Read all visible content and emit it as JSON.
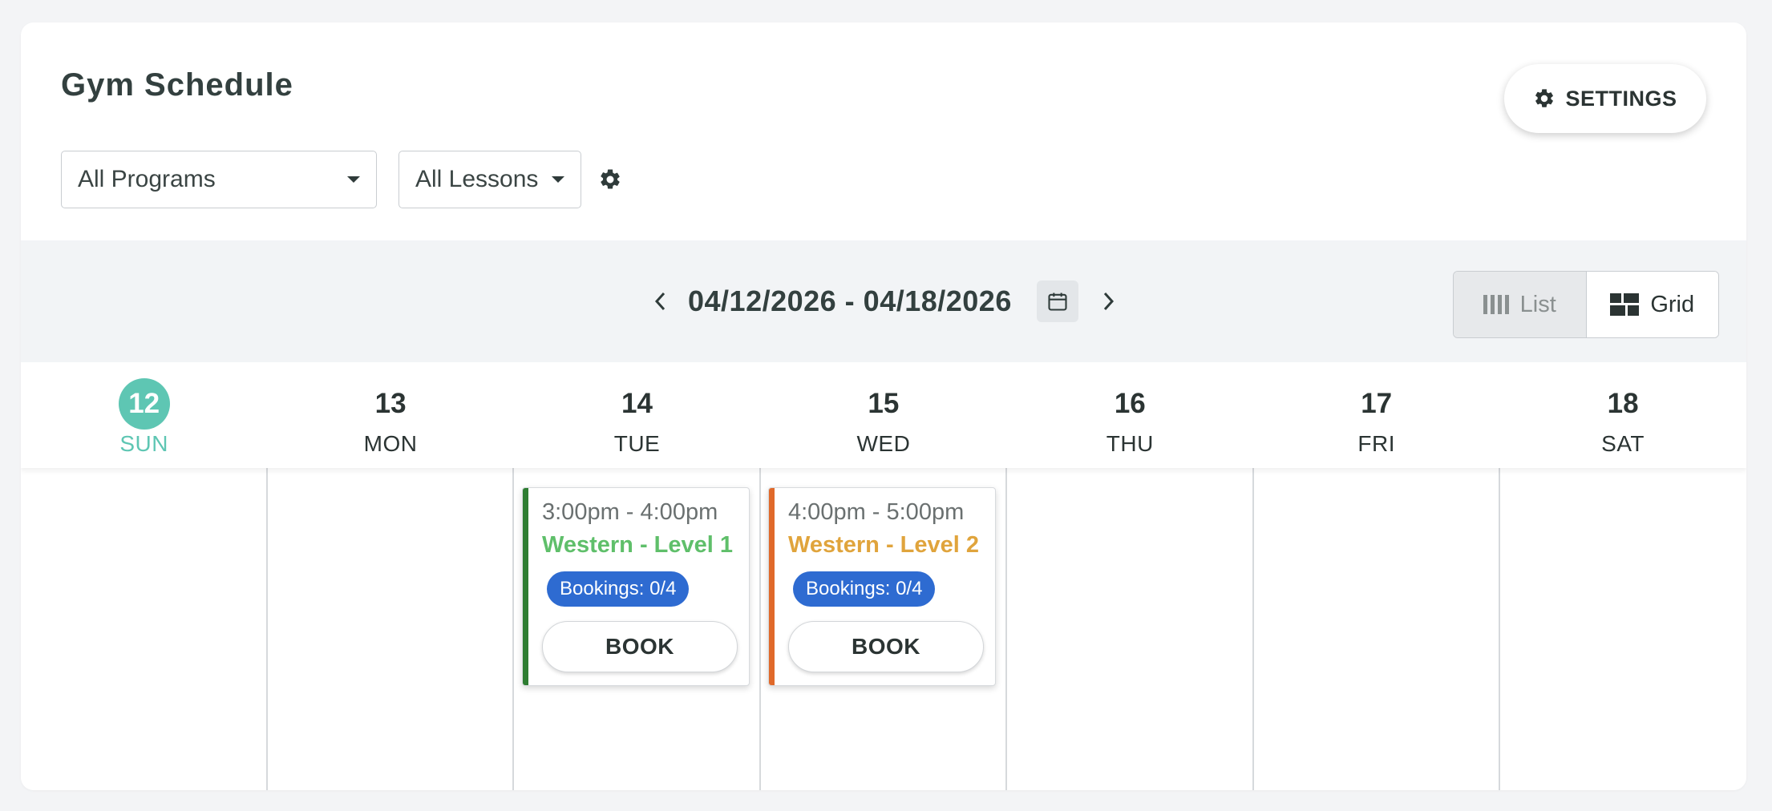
{
  "header": {
    "title": "Gym Schedule",
    "settings_label": "SETTINGS"
  },
  "filters": {
    "programs": {
      "selected": "All Programs"
    },
    "lessons": {
      "selected": "All Lessons"
    }
  },
  "toolbar": {
    "date_range": "04/12/2026 - 04/18/2026",
    "views": [
      {
        "label": "List",
        "icon": "list-columns-icon",
        "active": true
      },
      {
        "label": "Grid",
        "icon": "grid-layout-icon",
        "active": false
      }
    ]
  },
  "days": [
    {
      "num": "12",
      "name": "SUN",
      "today": true
    },
    {
      "num": "13",
      "name": "MON",
      "today": false
    },
    {
      "num": "14",
      "name": "TUE",
      "today": false
    },
    {
      "num": "15",
      "name": "WED",
      "today": false
    },
    {
      "num": "16",
      "name": "THU",
      "today": false
    },
    {
      "num": "17",
      "name": "FRI",
      "today": false
    },
    {
      "num": "18",
      "name": "SAT",
      "today": false
    }
  ],
  "events": [
    {
      "day": "TUE",
      "time": "3:00pm - 4:00pm",
      "name": "Western - Level 1",
      "bookings": "Bookings: 0/4",
      "book_label": "BOOK",
      "name_color": "#5fbf6a",
      "bar_color": "#2e7d32"
    },
    {
      "day": "WED",
      "time": "4:00pm - 5:00pm",
      "name": "Western - Level 2",
      "bookings": "Bookings: 0/4",
      "book_label": "BOOK",
      "name_color": "#e0a43c",
      "bar_color": "#e0692a"
    }
  ],
  "colors": {
    "accent_today": "#5ec6b3",
    "badge": "#2e6bd1"
  }
}
